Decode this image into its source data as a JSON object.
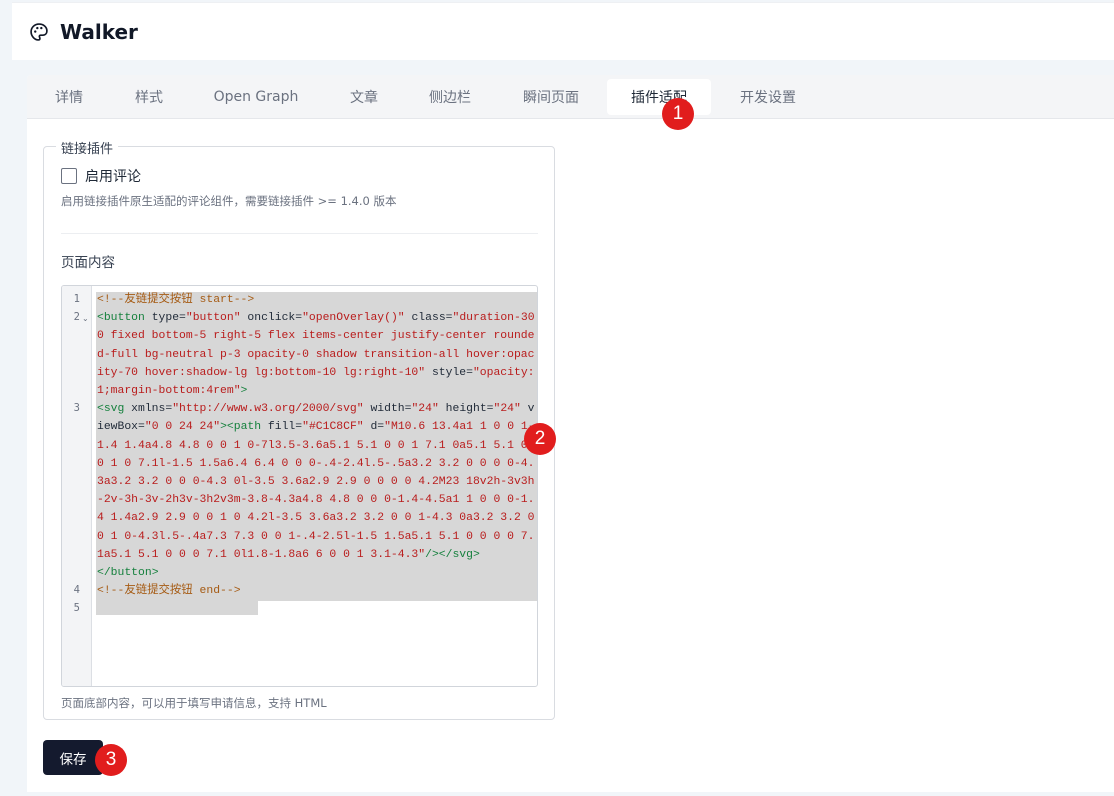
{
  "app": {
    "title": "Walker",
    "logo_icon": "palette-icon"
  },
  "tabs": [
    {
      "label": "详情",
      "active": false
    },
    {
      "label": "样式",
      "active": false
    },
    {
      "label": "Open Graph",
      "active": false
    },
    {
      "label": "文章",
      "active": false
    },
    {
      "label": "侧边栏",
      "active": false
    },
    {
      "label": "瞬间页面",
      "active": false
    },
    {
      "label": "插件适配",
      "active": true
    },
    {
      "label": "开发设置",
      "active": false
    }
  ],
  "section": {
    "legend": "链接插件",
    "enable_comment": {
      "label": "启用评论",
      "checked": false
    },
    "enable_comment_help": "启用链接插件原生适配的评论组件，需要链接插件 >= 1.4.0 版本",
    "page_content_label": "页面内容",
    "page_content_help": "页面底部内容，可以用于填写申请信息，支持 HTML"
  },
  "editor": {
    "line_numbers": [
      "1",
      "2",
      "3",
      "4",
      "5"
    ],
    "lines": [
      "<!--友链提交按钮 start-->",
      "<button type=\"button\" onclick=\"openOverlay()\" class=\"duration-300 fixed bottom-5 right-5 flex items-center justify-center rounded-full bg-neutral p-3 opacity-0 shadow transition-all hover:opacity-70 hover:shadow-lg lg:bottom-10 lg:right-10\" style=\"opacity: 1;margin-bottom:4rem\">",
      "<svg xmlns=\"http://www.w3.org/2000/svg\" width=\"24\" height=\"24\" viewBox=\"0 0 24 24\"><path fill=\"#C1C8CF\" d=\"M10.6 13.4a1 1 0 0 1-1.4 1.4a4.8 4.8 0 0 1 0-7l3.5-3.6a5.1 5.1 0 0 1 7.1 0a5.1 5.1 0 0 1 0 7.1l-1.5 1.5a6.4 6.4 0 0 0-.4-2.4l.5-.5a3.2 3.2 0 0 0 0-4.3a3.2 3.2 0 0 0-4.3 0l-3.5 3.6a2.9 2.9 0 0 0 0 4.2M23 18v2h-3v3h-2v-3h-3v-2h3v-3h2v3m-3.8-4.3a4.8 4.8 0 0 0-1.4-4.5a1 1 0 0 0-1.4 1.4a2.9 2.9 0 0 1 0 4.2l-3.5 3.6a3.2 3.2 0 0 1-4.3 0a3.2 3.2 0 0 1 0-4.3l.5-.4a7.3 7.3 0 0 1-.4-2.5l-1.5 1.5a5.1 5.1 0 0 0 0 7.1a5.1 5.1 0 0 0 7.1 0l1.8-1.8a6 6 0 0 1 3.1-4.3\"/></svg>",
      "</button>",
      "<!--友链提交按钮 end-->"
    ]
  },
  "actions": {
    "save_label": "保存"
  },
  "badges": [
    "1",
    "2",
    "3"
  ],
  "colors": {
    "primary_button": "#141a2e",
    "badge": "#e11d1d",
    "selection": "#d7d7d7",
    "code_tag": "#15803d",
    "code_string": "#b91c1c",
    "code_comment": "#a55a12"
  }
}
